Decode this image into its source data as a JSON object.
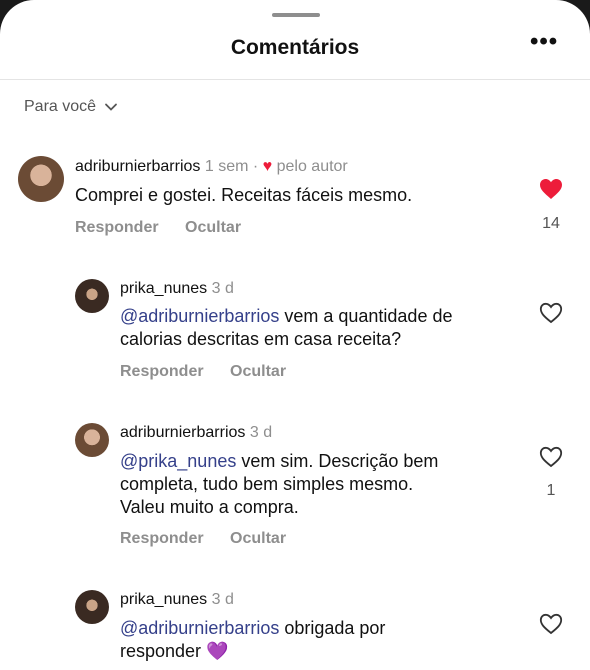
{
  "header": {
    "title": "Comentários",
    "more_label": "•••"
  },
  "sort": {
    "label": "Para você"
  },
  "comments": [
    {
      "username": "adriburnierbarrios",
      "time": "1 sem ·",
      "liked_by_author": "pelo autor",
      "text": "Comprei e gostei. Receitas fáceis mesmo.",
      "reply_label": "Responder",
      "hide_label": "Ocultar",
      "likes": "14",
      "liked": true
    },
    {
      "username": "prika_nunes",
      "time": "3 d",
      "mention": "@adriburnierbarrios",
      "text_a": " vem a quantidade de",
      "text_b": "calorias descritas em casa receita?",
      "reply_label": "Responder",
      "hide_label": "Ocultar",
      "likes": "",
      "liked": false
    },
    {
      "username": "adriburnierbarrios",
      "time": "3 d",
      "mention": "@prika_nunes",
      "text_a": " vem sim. Descrição bem",
      "text_b": "completa, tudo bem simples mesmo.",
      "text_c": "Valeu muito a compra.",
      "reply_label": "Responder",
      "hide_label": "Ocultar",
      "likes": "1",
      "liked": false
    },
    {
      "username": "prika_nunes",
      "time": "3 d",
      "mention": "@adriburnierbarrios",
      "text_a": " obrigada por",
      "text_b": "responder",
      "emoji": "💜",
      "liked": false
    }
  ],
  "colors": {
    "like_red": "#ed1c3a",
    "mention": "#35408a",
    "meta": "#8e8e8e"
  }
}
